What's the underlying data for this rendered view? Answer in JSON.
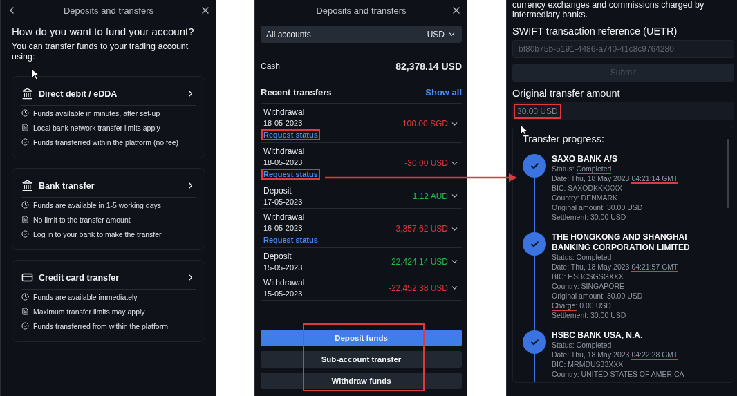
{
  "fund_screen": {
    "title": "Deposits and transfers",
    "heading": "How do you want to fund your account?",
    "subtitle": "You can transfer funds to your trading account using:",
    "methods": [
      {
        "kind": "bank",
        "title": "Direct debit / eDDA",
        "features": [
          {
            "kind": "timing",
            "text": "Funds available in minutes, after set-up"
          },
          {
            "kind": "limit",
            "text": "Local bank network transfer limits apply"
          },
          {
            "kind": "method",
            "text": "Funds transferred within the platform (no fee)"
          }
        ]
      },
      {
        "kind": "bank",
        "title": "Bank transfer",
        "features": [
          {
            "kind": "timing",
            "text": "Funds are available in 1-5 working days"
          },
          {
            "kind": "limit",
            "text": "No limit to the transfer amount"
          },
          {
            "kind": "method",
            "text": "Log in to your bank to make the transfer"
          }
        ]
      },
      {
        "kind": "card",
        "title": "Credit card transfer",
        "features": [
          {
            "kind": "timing",
            "text": "Funds are available immediately"
          },
          {
            "kind": "limit",
            "text": "Maximum transfer limits may apply"
          },
          {
            "kind": "method",
            "text": "Funds transferred from within the platform"
          }
        ]
      }
    ]
  },
  "transfers_screen": {
    "title": "Deposits and transfers",
    "account_select": {
      "value": "All accounts",
      "currency": "USD"
    },
    "cash": {
      "label": "Cash",
      "value": "82,378.14 USD"
    },
    "recent_title": "Recent transfers",
    "show_all": "Show all",
    "transfers": [
      {
        "kind": "withdrawal",
        "type": "Withdrawal",
        "date": "18-05-2023",
        "amount": "-100.00 SGD",
        "status_link": "Request status",
        "highlighted": true
      },
      {
        "kind": "withdrawal",
        "type": "Withdrawal",
        "date": "18-05-2023",
        "amount": "-30.00 USD",
        "status_link": "Request status",
        "highlighted": true
      },
      {
        "kind": "deposit",
        "type": "Deposit",
        "date": "17-05-2023",
        "amount": "1.12 AUD"
      },
      {
        "kind": "withdrawal",
        "type": "Withdrawal",
        "date": "16-05-2023",
        "amount": "-3,357.62 USD",
        "status_link": "Request status",
        "highlighted": false
      },
      {
        "kind": "deposit",
        "type": "Deposit",
        "date": "15-05-2023",
        "amount": "22,424.14 USD"
      },
      {
        "kind": "withdrawal",
        "type": "Withdrawal",
        "date": "15-05-2023",
        "amount": "-22,452.38 USD"
      }
    ],
    "buttons": [
      {
        "label": "Deposit funds",
        "primary": true
      },
      {
        "label": "Sub-account transfer",
        "primary": false
      },
      {
        "label": "Withdraw funds",
        "primary": false
      }
    ],
    "buttons_highlighted": true
  },
  "status_screen": {
    "intro": "currency exchanges and commissions charged by intermediary banks.",
    "reference_label": "SWIFT transaction reference (UETR)",
    "reference_placeholder": "bf80b75b-5191-4486-a740-41c8c9764280",
    "submit_label": "Submit",
    "submit_disabled": true,
    "amount_label": "Original transfer amount",
    "amount_value": "30.00 USD",
    "amount_highlighted": true,
    "progress_title": "Transfer progress:",
    "steps": [
      {
        "bank": "SAXO BANK A/S",
        "lines": [
          {
            "parts": [
              {
                "text": "Status: ",
                "marked": false
              },
              {
                "text": "Completed",
                "marked": true
              }
            ]
          },
          {
            "parts": [
              {
                "text": "Date: Thu, 18 May 2023 ",
                "marked": false
              },
              {
                "text": "04:21:14 GMT",
                "marked": true
              }
            ]
          },
          {
            "parts": [
              {
                "text": "BIC: SAXODKKKXXX",
                "marked": false
              }
            ]
          },
          {
            "parts": [
              {
                "text": "Country: DENMARK",
                "marked": false
              }
            ]
          },
          {
            "parts": [
              {
                "text": "Original amount: 30.00 USD",
                "marked": false
              }
            ]
          },
          {
            "parts": [
              {
                "text": "Settlement: 30.00 USD",
                "marked": false
              }
            ]
          }
        ]
      },
      {
        "bank": "THE HONGKONG AND SHANGHAI BANKING CORPORATION LIMITED",
        "lines": [
          {
            "parts": [
              {
                "text": "Status: Completed",
                "marked": false
              }
            ]
          },
          {
            "parts": [
              {
                "text": "Date: Thu, 18 May 2023 ",
                "marked": false
              },
              {
                "text": "04:21:57 GMT",
                "marked": true
              }
            ]
          },
          {
            "parts": [
              {
                "text": "BIC: HSBCSGSGXXX",
                "marked": false
              }
            ]
          },
          {
            "parts": [
              {
                "text": "Country: SINGAPORE",
                "marked": false
              }
            ]
          },
          {
            "parts": [
              {
                "text": "Original amount: 30.00 USD",
                "marked": false
              }
            ]
          },
          {
            "parts": [
              {
                "text": "Charge:",
                "marked": true
              },
              {
                "text": " 0.00 USD",
                "marked": false
              }
            ]
          },
          {
            "parts": [
              {
                "text": "Settlement: 30.00 USD",
                "marked": false
              }
            ]
          }
        ]
      },
      {
        "bank": "HSBC BANK USA, N.A.",
        "lines": [
          {
            "parts": [
              {
                "text": "Status: Completed",
                "marked": false
              }
            ]
          },
          {
            "parts": [
              {
                "text": "Date: Thu, 18 May 2023 ",
                "marked": false
              },
              {
                "text": "04:22:28 GMT",
                "marked": true
              }
            ]
          },
          {
            "parts": [
              {
                "text": "BIC: MRMDUS33XXX",
                "marked": false
              }
            ]
          },
          {
            "parts": [
              {
                "text": "Country: UNITED STATES OF AMERICA",
                "marked": false
              }
            ]
          }
        ]
      }
    ]
  },
  "annotation_arrow": true
}
